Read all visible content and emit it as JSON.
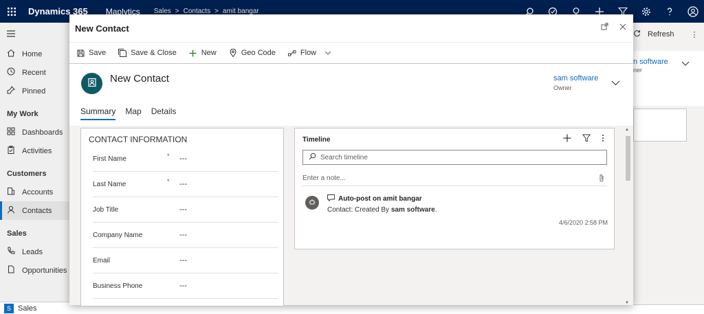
{
  "topbar": {
    "brand": "Dynamics 365",
    "app": "Maplytics",
    "breadcrumb": [
      "Sales",
      ">",
      "Contacts",
      ">",
      "amit bangar"
    ]
  },
  "sitemap": {
    "items": [
      {
        "label": "Home",
        "icon": "home-icon"
      },
      {
        "label": "Recent",
        "icon": "clock-icon"
      },
      {
        "label": "Pinned",
        "icon": "pin-icon"
      }
    ],
    "groups": [
      {
        "label": "My Work",
        "items": [
          {
            "label": "Dashboards"
          },
          {
            "label": "Activities"
          }
        ]
      },
      {
        "label": "Customers",
        "items": [
          {
            "label": "Accounts"
          },
          {
            "label": "Contacts"
          }
        ]
      },
      {
        "label": "Sales",
        "items": [
          {
            "label": "Leads"
          },
          {
            "label": "Opportunities"
          }
        ]
      }
    ],
    "area": {
      "badge": "S",
      "label": "Sales"
    }
  },
  "background": {
    "refresh": "Refresh",
    "owner_name": "n software",
    "owner_label": "ner"
  },
  "dialog": {
    "title": "New Contact",
    "commands": [
      {
        "label": "Save",
        "icon": "save-icon"
      },
      {
        "label": "Save & Close",
        "icon": "save-close-icon"
      },
      {
        "label": "New",
        "icon": "plus-icon"
      },
      {
        "label": "Geo Code",
        "icon": "location-pin-icon"
      },
      {
        "label": "Flow",
        "icon": "flow-icon"
      }
    ],
    "record_title": "New Contact",
    "owner": {
      "name": "sam software",
      "label": "Owner"
    },
    "tabs": [
      "Summary",
      "Map",
      "Details"
    ],
    "section": {
      "header": "CONTACT INFORMATION",
      "fields": [
        {
          "label": "First Name",
          "req": "*",
          "value": "---"
        },
        {
          "label": "Last Name",
          "req": "*",
          "value": "---"
        },
        {
          "label": "Job Title",
          "req": "",
          "value": "---"
        },
        {
          "label": "Company Name",
          "req": "",
          "value": "---"
        },
        {
          "label": "Email",
          "req": "",
          "value": "---"
        },
        {
          "label": "Business Phone",
          "req": "",
          "value": "---"
        }
      ]
    },
    "timeline": {
      "title": "Timeline",
      "search_placeholder": "Search timeline",
      "note_placeholder": "Enter a note...",
      "post": {
        "title": "Auto-post on amit bangar",
        "desc_prefix": "Contact: Created By ",
        "desc_user": "sam software",
        "desc_suffix": ".",
        "date": "4/6/2020 2:58 PM"
      }
    }
  }
}
